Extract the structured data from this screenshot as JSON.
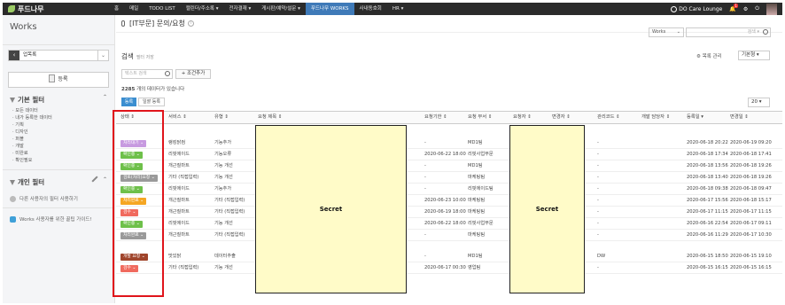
{
  "app": {
    "logo": "푸드나무",
    "nav": [
      "홈",
      "메일",
      "TODO LIST",
      "캘린더/주소록 ▾",
      "전자결재 ▾",
      "게시판/예약/설문 ▾",
      "푸드나무 WORKS",
      "사내동호회",
      "HR ▾"
    ],
    "active_nav_index": 6,
    "care_lounge": "DO Care Lounge",
    "notification_count": "1"
  },
  "sidebar": {
    "title": "Works",
    "select_value": "업목록",
    "register_label": "등록",
    "basic_filter_title": "기본 필터",
    "basic_filters": [
      "· 모든 데이터",
      "· 내가 등록한 데이터",
      "· 기획",
      "· 디자인",
      "· 퍼블",
      "· 개발",
      "· 미완료",
      "· 확인필요"
    ],
    "personal_filter_title": "개인 필터",
    "other_user_filter": "다른 사용자의 필터 사용하기",
    "guide_link": "Works 사용자를 위한 꿀팁 가이드!"
  },
  "main": {
    "page_title": "[IT부문] 문의/요청",
    "works_select": "Works",
    "top_search_placeholder": "검색 ▾",
    "search_label": "검색",
    "search_sub": "필터 저장",
    "list_mgmt": "목록 관리",
    "sort_select": "기본형 ▾",
    "text_search_placeholder": "텍스트 검색",
    "add_condition": "+ 조건추가",
    "count_number": "2285",
    "count_suffix": "개의 데이터가 있습니다",
    "tab_register": "등록",
    "tab_bulk": "일괄 등록",
    "page_size": "20 ▾"
  },
  "table": {
    "columns": [
      "상태 ⇕",
      "서비스 ⇕",
      "유형 ⇕",
      "요청 제목 ⇕",
      "요청기한 ⇕",
      "요청 부서 ⇕",
      "요청자 ⇕",
      "변경자 ⇕",
      "관리코드 ⇕",
      "개발 담당자 ⇕",
      "등록일 ▾",
      "변경일 ⇕"
    ],
    "rows": [
      {
        "status": "처리대기 ⌄",
        "service": "랭킹닭컴",
        "type": "기능추가",
        "deadline": "-",
        "dept": "MD1팀",
        "code": "-",
        "reg": "2020-06-18 20:22",
        "mod": "2020-06-19 09:20"
      },
      {
        "status": "확인중 ⌄",
        "service": "리핏에이드",
        "type": "기능오류",
        "deadline": "2020-06-22 18:00",
        "dept": "리핏사업부문",
        "code": "-",
        "reg": "2020-06-18 17:34",
        "mod": "2020-06-18 17:41"
      },
      {
        "status": "확인중 ⌄",
        "service": "개근질마트",
        "type": "기능 개선",
        "deadline": "-",
        "dept": "MD1팀",
        "code": "-",
        "reg": "2020-06-18 13:56",
        "mod": "2020-06-18 19:26"
      },
      {
        "status": "검토(처리)요청 ⌄",
        "service": "기타 (직접입력)",
        "type": "기능 개선",
        "deadline": "-",
        "dept": "마케팅팀",
        "code": "-",
        "reg": "2020-06-18 13:40",
        "mod": "2020-06-18 19:26"
      },
      {
        "status": "확인중 ⌄",
        "service": "리핏에이드",
        "type": "기능추가",
        "deadline": "-",
        "dept": "리핏에이드팀",
        "code": "-",
        "reg": "2020-06-18 09:38",
        "mod": "2020-06-18 09:47"
      },
      {
        "status": "처리완료 ⌄",
        "service": "개근질마트",
        "type": "기타 (직접입력)",
        "deadline": "2020-06-23 10:00",
        "dept": "마케팅팀",
        "code": "-",
        "reg": "2020-06-17 15:56",
        "mod": "2020-06-18 15:17"
      },
      {
        "status": "검수 ⌄",
        "service": "개근질마트",
        "type": "기타 (직접입력)",
        "deadline": "2020-06-19 18:00",
        "dept": "마케팅팀",
        "code": "-",
        "reg": "2020-06-17 11:15",
        "mod": "2020-06-17 11:15"
      },
      {
        "status": "확인중 ⌄",
        "service": "리핏에이드",
        "type": "기능 개선",
        "deadline": "2020-06-22 18:00",
        "dept": "리핏사업부문",
        "code": "-",
        "reg": "2020-06-16 22:54",
        "mod": "2020-06-17 09:11"
      },
      {
        "status": "처리완료 ⌄",
        "service": "개근질마트",
        "type": "기타 (직접입력)",
        "deadline": "-",
        "dept": "마케팅팀",
        "code": "-",
        "reg": "2020-06-16 11:29",
        "mod": "2020-06-17 10:30"
      },
      {
        "status": "개발 요청 ⌄",
        "service": "맛있닭",
        "type": "데이터추출",
        "deadline": "-",
        "dept": "MD1팀",
        "code": "DW",
        "reg": "2020-06-15 18:50",
        "mod": "2020-06-15 19:10"
      },
      {
        "status": "검수 ⌄",
        "service": "기타 (직접입력)",
        "type": "기능 개선",
        "deadline": "2020-06-17 00:30",
        "dept": "영업팀",
        "code": "-",
        "reg": "2020-06-15 16:15",
        "mod": "2020-06-15 16:15"
      }
    ],
    "status_colors": {
      "처리대기 ⌄": "#c79ae0",
      "확인중 ⌄": "#6ec04a",
      "검토(처리)요청 ⌄": "#9a9a9a",
      "처리완료 ⌄": "#9a9a9a",
      "검수 ⌄": "#f06a5e",
      "개발 요청 ⌄": "#a0452c"
    },
    "special_status_colors": [
      "#c79ae0",
      "#6ec04a",
      "#6ec04a",
      "#9a9a9a",
      "#6ec04a",
      "#f5a623",
      "#f06a5e",
      "#6ec04a",
      "#9a9a9a",
      "#a0452c",
      "#f06a5e"
    ],
    "secret_label": "Secret"
  }
}
